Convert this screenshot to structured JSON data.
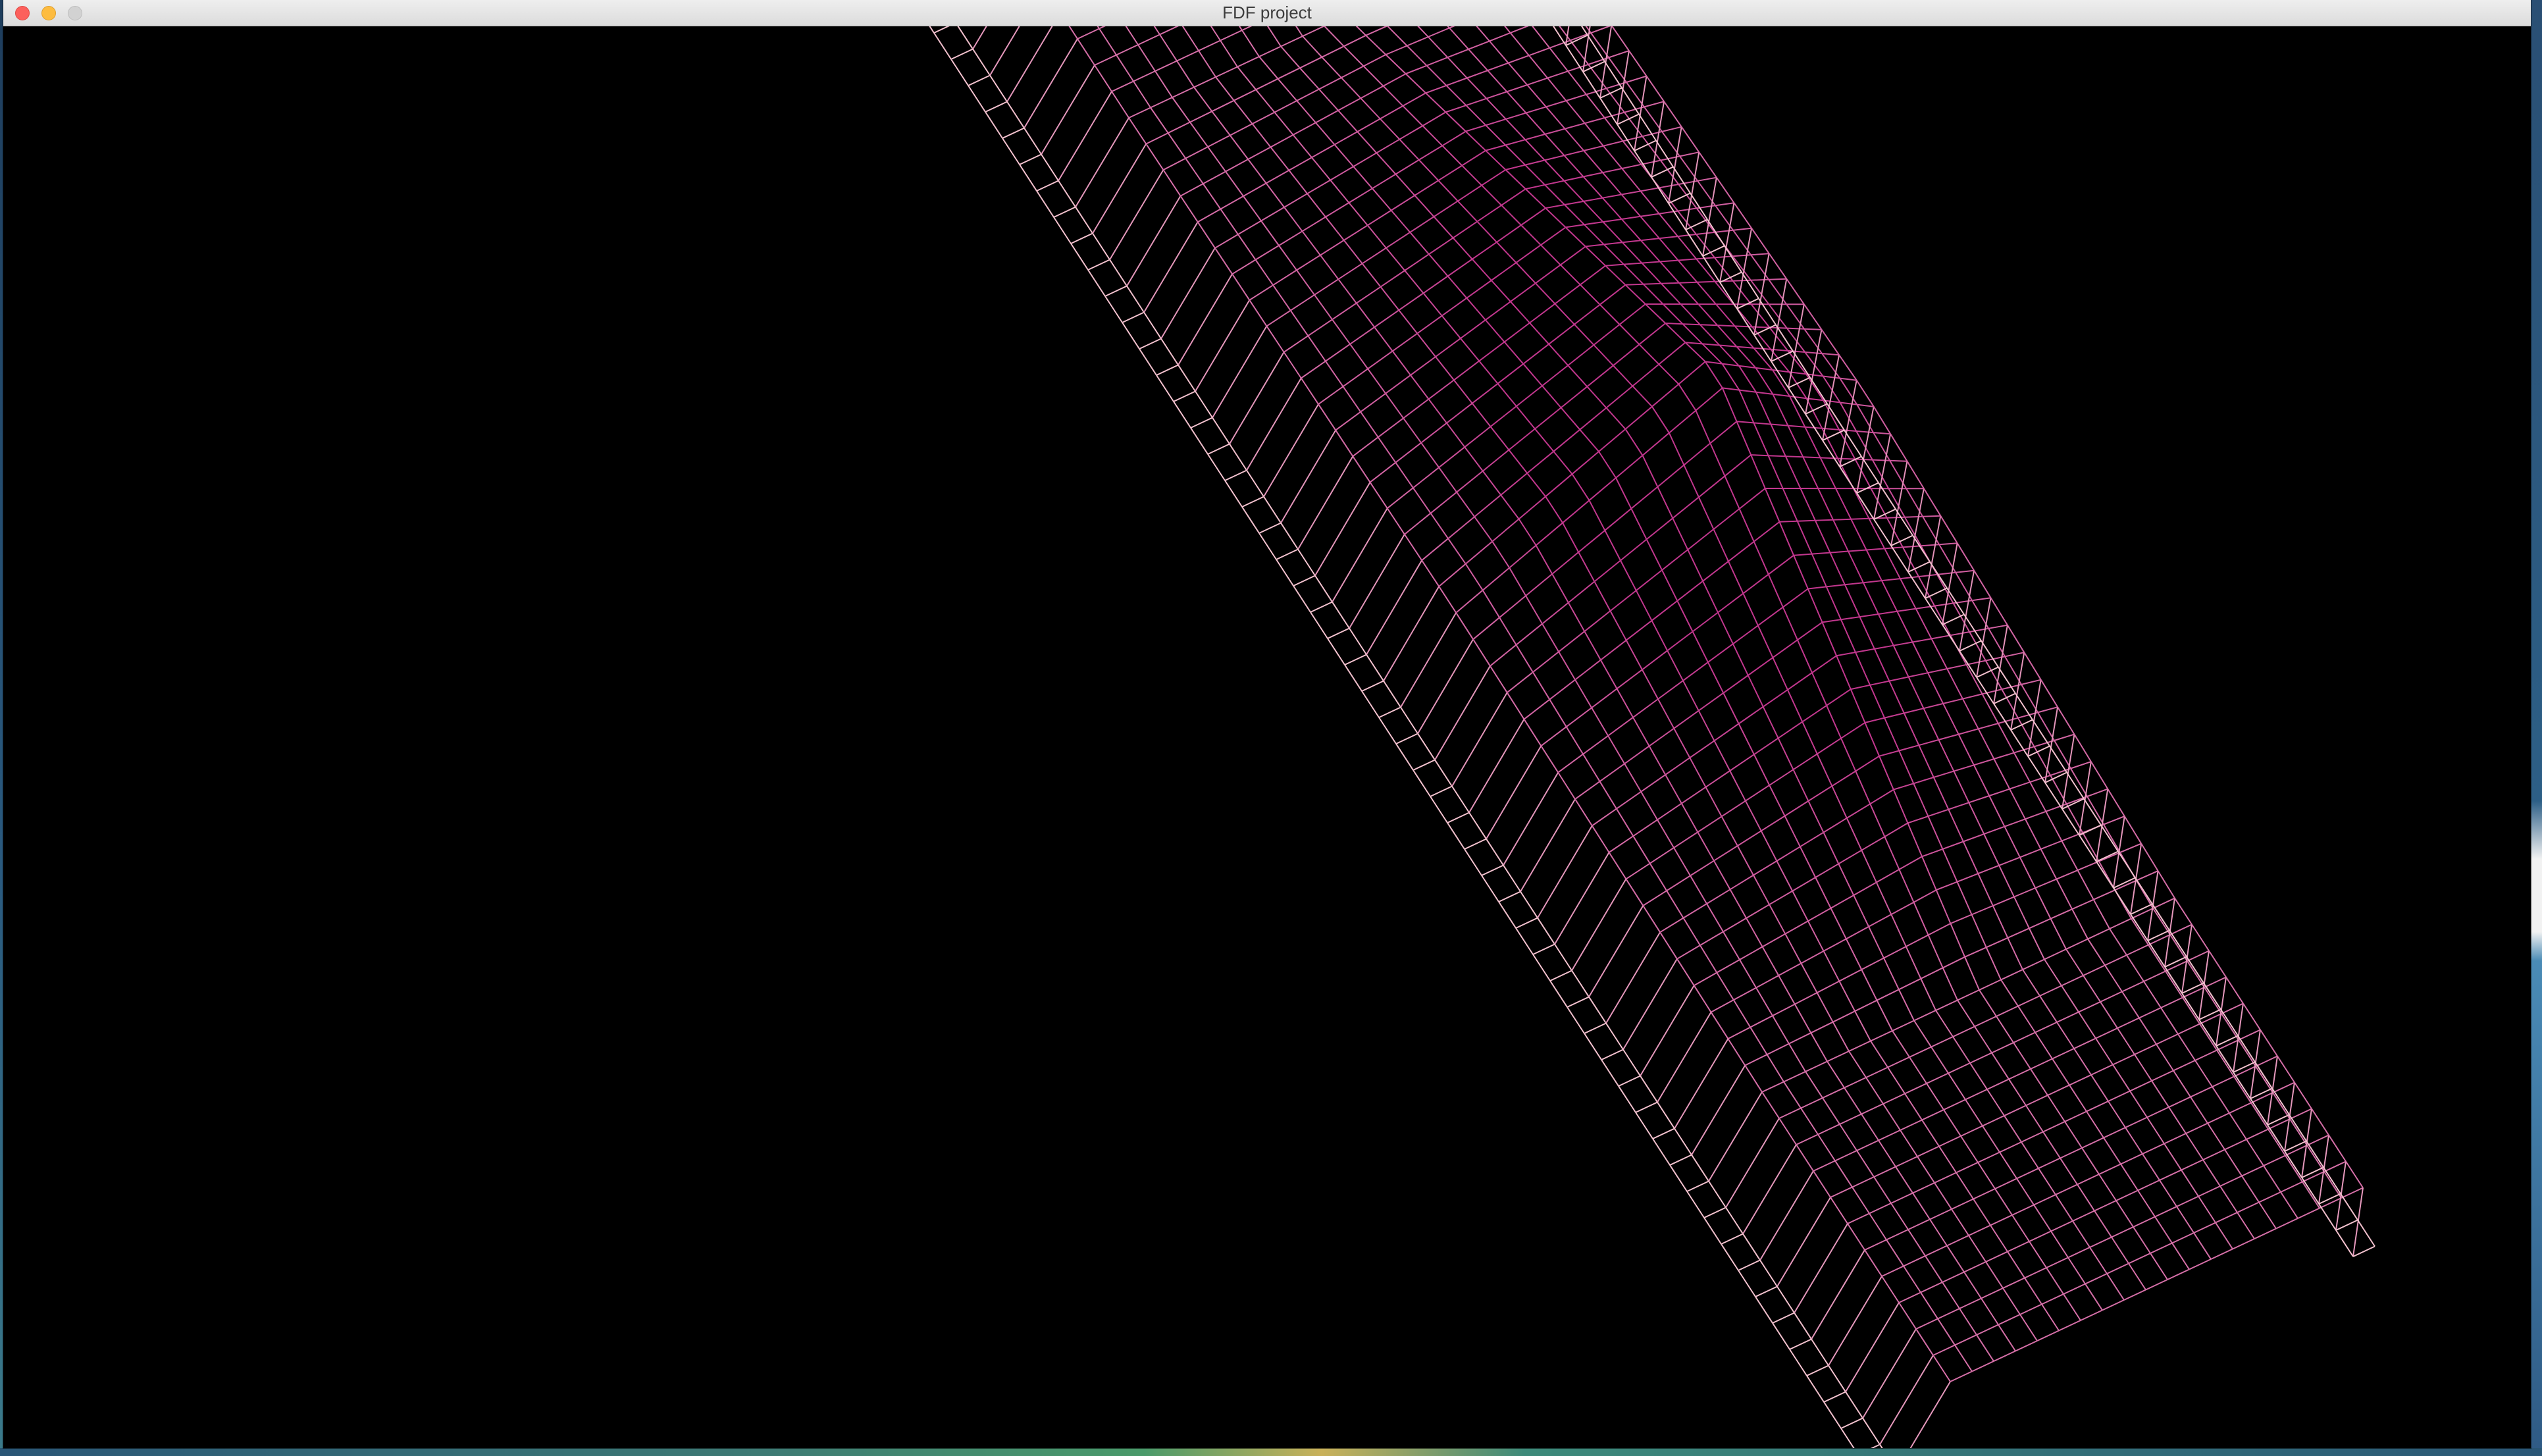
{
  "window": {
    "title": "FDF project"
  },
  "controls": {
    "close": "close",
    "minimize": "minimize",
    "zoom": "zoom"
  },
  "render": {
    "background": "#000000",
    "colors": {
      "low": "#f4c2cf",
      "high": "#c2378e",
      "mid": "#e05c9c"
    }
  }
}
